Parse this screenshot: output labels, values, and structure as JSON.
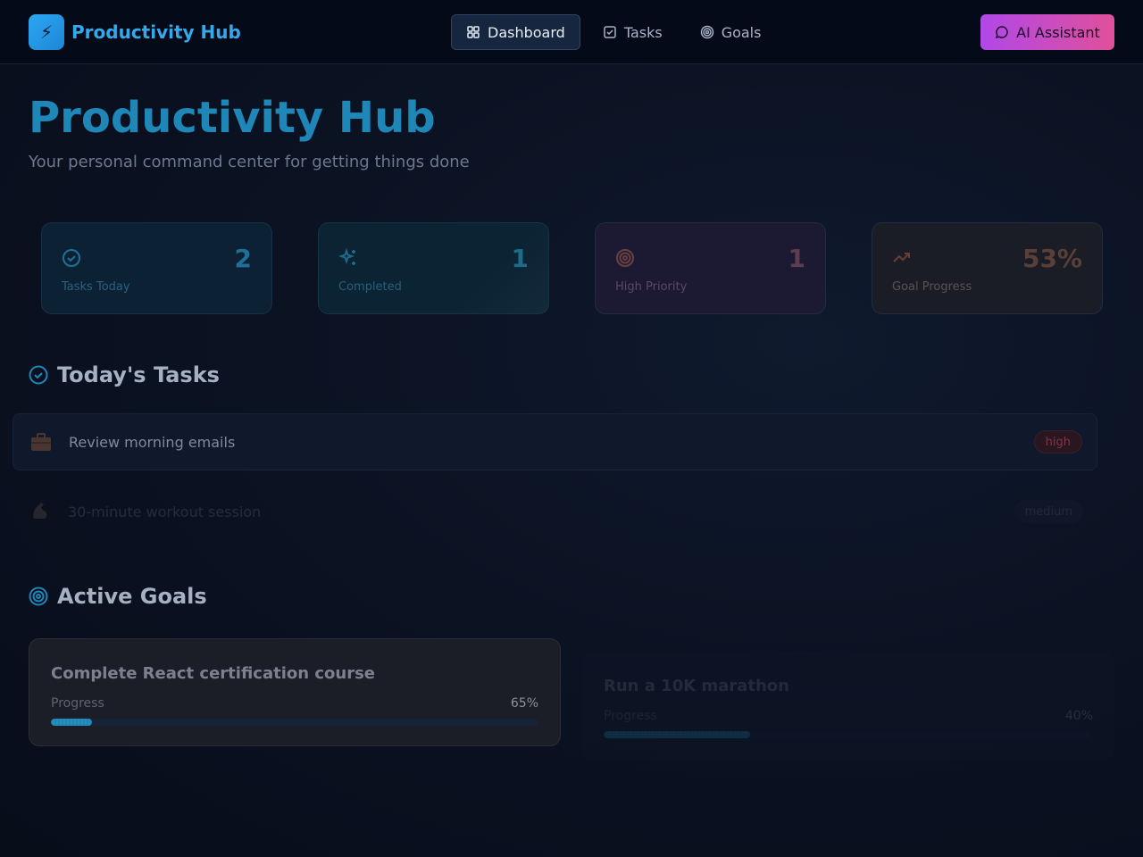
{
  "app": {
    "brand_name": "Productivity Hub",
    "brand_icon": "lightning-icon"
  },
  "nav": {
    "items": [
      {
        "label": "Dashboard",
        "icon": "grid-icon",
        "active": true
      },
      {
        "label": "Tasks",
        "icon": "checkbox-icon",
        "active": false
      },
      {
        "label": "Goals",
        "icon": "target-icon",
        "active": false
      }
    ],
    "ai_button": {
      "label": "AI Assistant",
      "icon": "chat-icon"
    }
  },
  "hero": {
    "title": "Productivity Hub",
    "subtitle": "Your personal command center for getting things done"
  },
  "stats": [
    {
      "label": "Tasks Today",
      "value": "2",
      "icon": "check-circle-icon"
    },
    {
      "label": "Completed",
      "value": "1",
      "icon": "sparkles-icon"
    },
    {
      "label": "High Priority",
      "value": "1",
      "icon": "target-icon"
    },
    {
      "label": "Goal Progress",
      "value": "53%",
      "icon": "trending-up-icon"
    }
  ],
  "tasks_section": {
    "title": "Today's Tasks",
    "icon": "check-circle-icon",
    "items": [
      {
        "name": "Review morning emails",
        "priority": "high",
        "icon": "briefcase-icon"
      },
      {
        "name": "30-minute workout session",
        "priority": "medium",
        "icon": "flexed-arm-icon"
      }
    ]
  },
  "goals_section": {
    "title": "Active Goals",
    "icon": "target-icon",
    "items": [
      {
        "title": "Complete React certification course",
        "progress_label": "Progress",
        "progress": "65%",
        "progress_value": 0.65
      },
      {
        "title": "Run a 10K marathon",
        "progress_label": "Progress",
        "progress": "40%",
        "progress_value": 0.4
      }
    ]
  },
  "colors": {
    "accent": "#35a8ea",
    "ai_gradient_start": "#b148e8",
    "ai_gradient_end": "#e0509a",
    "background": "#0b1120"
  }
}
